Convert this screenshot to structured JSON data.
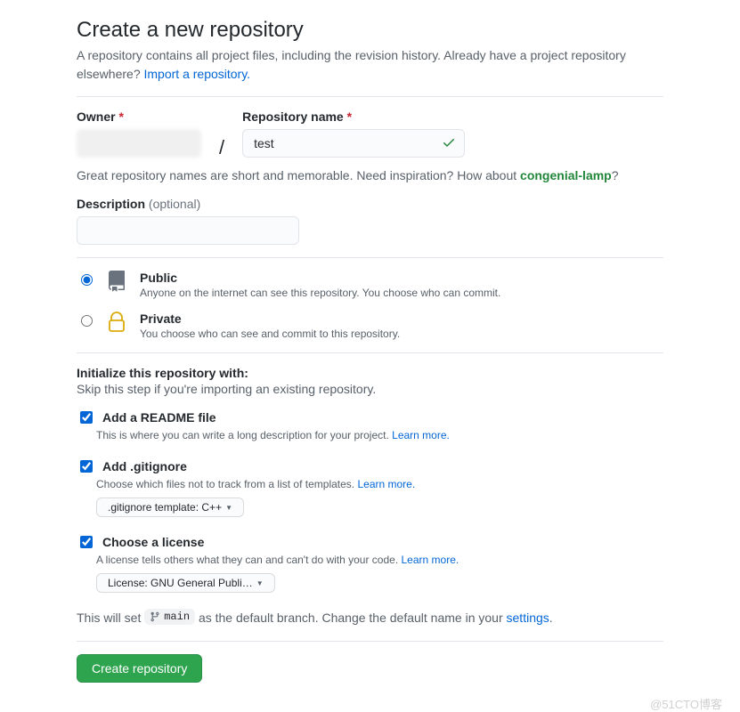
{
  "heading": "Create a new repository",
  "subhead_a": "A repository contains all project files, including the revision history. Already have a project repository elsewhere? ",
  "import_link": "Import a repository.",
  "owner_label": "Owner",
  "name_label": "Repository name",
  "required_mark": "*",
  "repo_name_value": "test",
  "name_hint_pre": "Great repository names are short and memorable. Need inspiration? How about ",
  "name_hint_suggestion": "congenial-lamp",
  "name_hint_post": "?",
  "desc_label": "Description",
  "desc_optional": "(optional)",
  "visibility": {
    "public": {
      "title": "Public",
      "desc": "Anyone on the internet can see this repository. You choose who can commit."
    },
    "private": {
      "title": "Private",
      "desc": "You choose who can see and commit to this repository."
    }
  },
  "init": {
    "head": "Initialize this repository with:",
    "sub": "Skip this step if you're importing an existing repository."
  },
  "readme": {
    "label": "Add a README file",
    "desc": "This is where you can write a long description for your project. ",
    "learn": "Learn more."
  },
  "gitignore": {
    "label": "Add .gitignore",
    "desc": "Choose which files not to track from a list of templates. ",
    "learn": "Learn more.",
    "selector": ".gitignore template: C++"
  },
  "license": {
    "label": "Choose a license",
    "desc": "A license tells others what they can and can't do with your code. ",
    "learn": "Learn more.",
    "selector": "License: GNU General Publi…"
  },
  "default_branch": {
    "pre": "This will set ",
    "branch": "main",
    "mid": " as the default branch. Change the default name in your ",
    "link": "settings",
    "post": "."
  },
  "submit": "Create repository",
  "watermark": "@51CTO博客"
}
